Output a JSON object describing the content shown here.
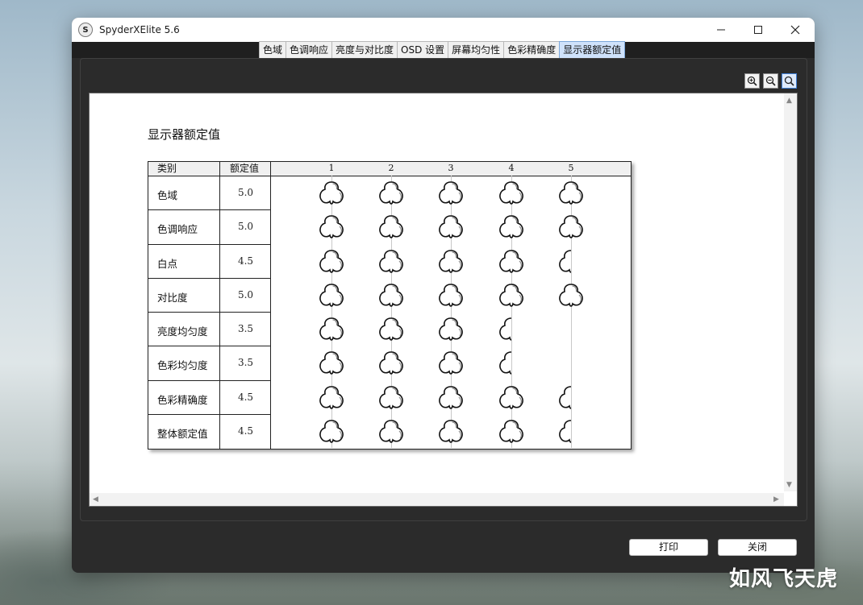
{
  "window": {
    "title": "SpyderXElite 5.6",
    "icon": "spyder-s-icon"
  },
  "tabs": [
    {
      "label": "色域",
      "active": false
    },
    {
      "label": "色调响应",
      "active": false
    },
    {
      "label": "亮度与对比度",
      "active": false
    },
    {
      "label": "OSD 设置",
      "active": false
    },
    {
      "label": "屏幕均匀性",
      "active": false
    },
    {
      "label": "色彩精确度",
      "active": false
    },
    {
      "label": "显示器额定值",
      "active": true
    }
  ],
  "zoom": {
    "icons": [
      "zoom-in-icon",
      "zoom-out-icon",
      "zoom-fit-icon"
    ]
  },
  "report": {
    "title": "显示器额定值",
    "col_category": "类别",
    "col_rating": "额定值",
    "scale": [
      "1",
      "2",
      "3",
      "4",
      "5"
    ],
    "rows": [
      {
        "category": "色域",
        "rating": "5.0",
        "value": 5.0
      },
      {
        "category": "色调响应",
        "rating": "5.0",
        "value": 5.0
      },
      {
        "category": "白点",
        "rating": "4.5",
        "value": 4.5
      },
      {
        "category": "对比度",
        "rating": "5.0",
        "value": 5.0
      },
      {
        "category": "亮度均匀度",
        "rating": "3.5",
        "value": 3.5
      },
      {
        "category": "色彩均匀度",
        "rating": "3.5",
        "value": 3.5
      },
      {
        "category": "色彩精确度",
        "rating": "4.5",
        "value": 4.5
      },
      {
        "category": "整体额定值",
        "rating": "4.5",
        "value": 4.5
      }
    ]
  },
  "buttons": {
    "print": "打印",
    "close": "关闭"
  },
  "watermark": "如风飞天虎",
  "colors": {
    "active_tab": "#cfe2fb",
    "window_bg": "#2b2b2b"
  }
}
